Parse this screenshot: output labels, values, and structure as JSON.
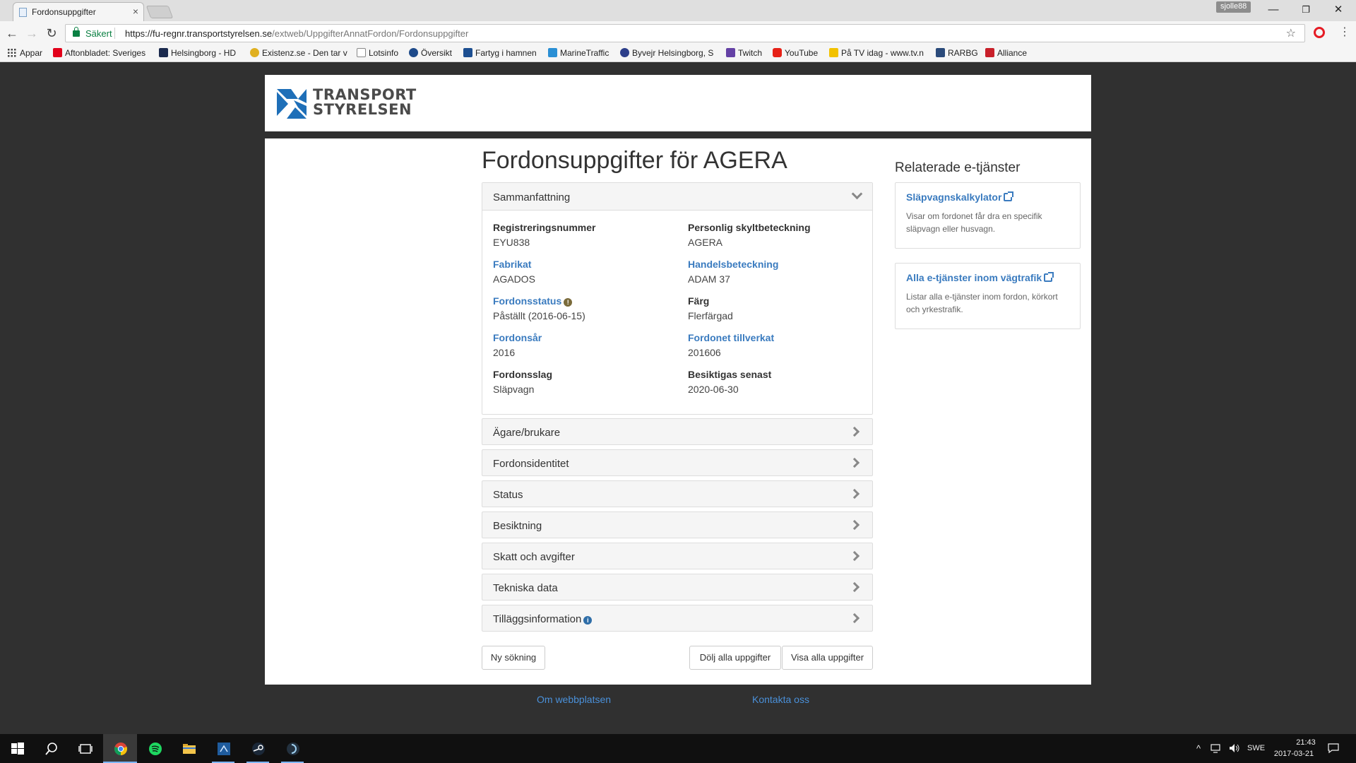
{
  "browser": {
    "tab_title": "Fordonsuppgifter",
    "tab_close": "×",
    "profile": "sjolle88",
    "secure_label": "Säkert",
    "url_host": "https://fu-regnr.transportstyrelsen.se",
    "url_path": "/extweb/UppgifterAnnatFordon/Fordonsuppgifter",
    "bookmarks": [
      {
        "label": "Appar"
      },
      {
        "label": "Aftonbladet: Sveriges"
      },
      {
        "label": "Helsingborg - HD"
      },
      {
        "label": "Existenz.se - Den tar v"
      },
      {
        "label": "Lotsinfo"
      },
      {
        "label": "Översikt"
      },
      {
        "label": "Fartyg i hamnen"
      },
      {
        "label": "MarineTraffic"
      },
      {
        "label": "Byvejr Helsingborg, S"
      },
      {
        "label": "Twitch"
      },
      {
        "label": "YouTube"
      },
      {
        "label": "På TV idag - www.tv.n"
      },
      {
        "label": "RARBG"
      },
      {
        "label": "Alliance"
      }
    ]
  },
  "site": {
    "logo_line1": "TRANSPORT",
    "logo_line2": "STYRELSEN",
    "title": "Fordonsuppgifter för AGERA",
    "summary_panel": "Sammanfattning",
    "fields": [
      {
        "label": "Registreringsnummer",
        "value": "EYU838",
        "link": false
      },
      {
        "label": "Personlig skyltbeteckning",
        "value": "AGERA",
        "link": false
      },
      {
        "label": "Fabrikat",
        "value": "AGADOS",
        "link": true
      },
      {
        "label": "Handelsbeteckning",
        "value": "ADAM 37",
        "link": true
      },
      {
        "label": "Fordonsstatus",
        "value": "Påställt (2016-06-15)",
        "link": true
      },
      {
        "label": "Färg",
        "value": "Flerfärgad",
        "link": false
      },
      {
        "label": "Fordonsår",
        "value": "2016",
        "link": true
      },
      {
        "label": "Fordonet tillverkat",
        "value": "201606",
        "link": true
      },
      {
        "label": "Fordonsslag",
        "value": "Släpvagn",
        "link": false
      },
      {
        "label": "Besiktigas senast",
        "value": "2020-06-30",
        "link": false
      }
    ],
    "panels": [
      "Ägare/brukare",
      "Fordonsidentitet",
      "Status",
      "Besiktning",
      "Skatt och avgifter",
      "Tekniska data",
      "Tilläggsinformation"
    ],
    "buttons": {
      "new_search": "Ny sökning",
      "hide_all": "Dölj alla uppgifter",
      "show_all": "Visa alla uppgifter"
    },
    "sidebar": {
      "title": "Relaterade e-tjänster",
      "cards": [
        {
          "link": "Släpvagnskalkylator",
          "desc": "Visar om fordonet får dra en specifik släpvagn eller husvagn."
        },
        {
          "link": "Alla e-tjänster inom vägtrafik",
          "desc": "Listar alla e-tjänster inom fordon, körkort och yrkestrafik."
        }
      ]
    },
    "footer": {
      "about": "Om webbplatsen",
      "contact": "Kontakta oss"
    }
  },
  "taskbar": {
    "language": "SWE",
    "time": "21:43",
    "date": "2017-03-21"
  },
  "colors": {
    "link": "#3a7bbf",
    "footer_link": "#4a90d9",
    "page_bg": "#303030",
    "logo_blue": "#1e6fb8"
  }
}
